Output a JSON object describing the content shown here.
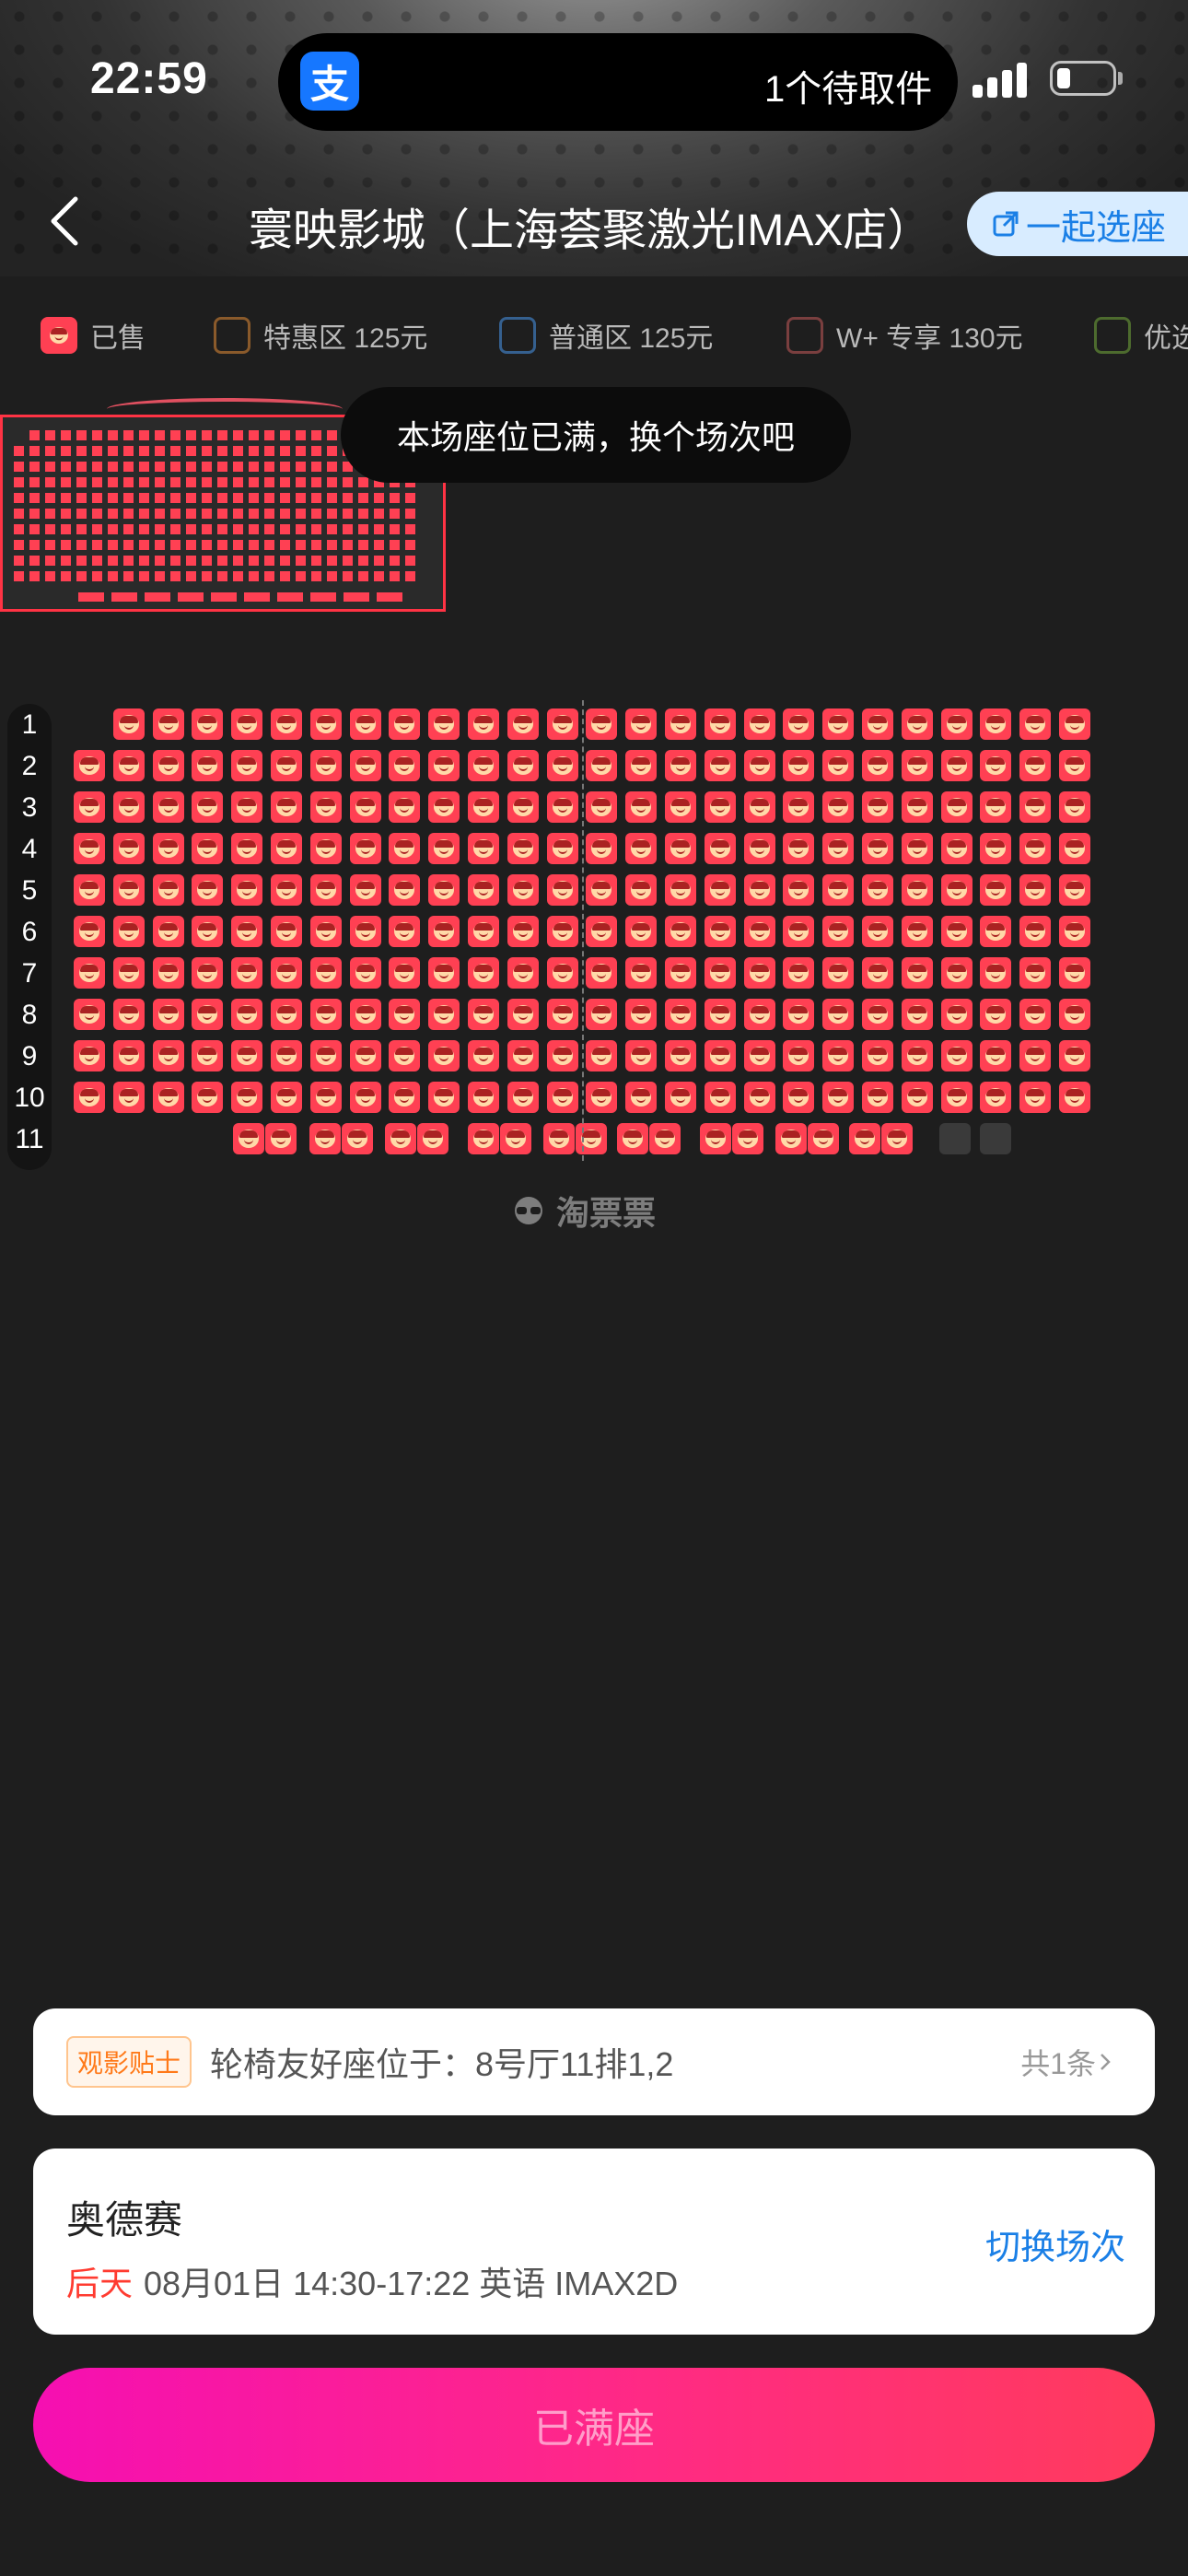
{
  "status_bar": {
    "time": "22:59",
    "app_icon_label": "支",
    "island_text": "1个待取件"
  },
  "header": {
    "back_icon": "chevron-left-icon",
    "title": "寰映影城（上海荟聚激光IMAX店）",
    "together_button": "一起选座"
  },
  "legend": [
    {
      "label": "已售",
      "price": "",
      "color": "#ff4053"
    },
    {
      "label": "特惠区",
      "price": "125元",
      "color": "#8a5a2b"
    },
    {
      "label": "普通区",
      "price": "125元",
      "color": "#35608f"
    },
    {
      "label": "W+ 专享",
      "price": "130元",
      "color": "#7a3f3f"
    },
    {
      "label": "优选",
      "price": "",
      "color": "#4d6b2e"
    }
  ],
  "toast": "本场座位已满，换个场次吧",
  "rows": [
    "1",
    "2",
    "3",
    "4",
    "5",
    "6",
    "7",
    "8",
    "9",
    "10",
    "11"
  ],
  "brand_watermark": "淘票票",
  "tip": {
    "badge": "观影贴士",
    "text": "轮椅友好座位于：8号厅11排1,2",
    "count": "共1条"
  },
  "movie": {
    "title": "奥德赛",
    "day": "后天",
    "details": "08月01日 14:30-17:22 英语 IMAX2D",
    "switch_label": "切换场次"
  },
  "action": {
    "button_label": "已满座"
  }
}
